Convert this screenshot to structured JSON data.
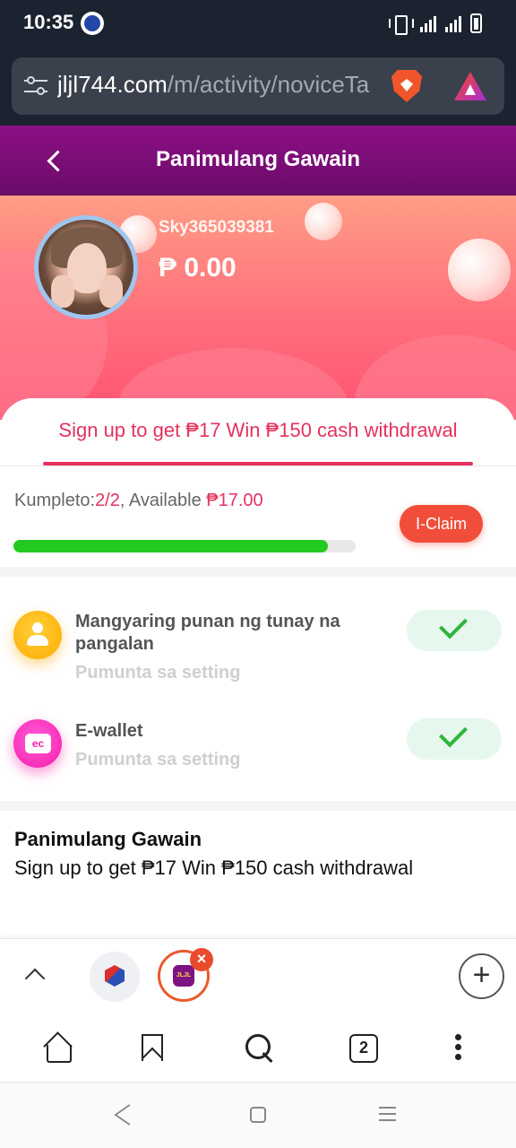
{
  "status_bar": {
    "time": "10:35"
  },
  "browser": {
    "url_host": "jljl744.com",
    "url_path": "/m/activity/noviceTa",
    "tabs_count": "2",
    "new_tab_symbol": "+",
    "tab_logo_text": "JLJL",
    "close_symbol": "×"
  },
  "header": {
    "title": "Panimulang Gawain"
  },
  "profile": {
    "username": "Sky365039381",
    "balance": "₱ 0.00"
  },
  "tab": {
    "label": "Sign up to get ₱17  Win ₱150 cash withdrawal"
  },
  "progress": {
    "label_prefix": "Kumpleto:",
    "completed": "2/2",
    "available_label": ", Available ",
    "available_amount": "₱17.00",
    "claim_label": "I-Claim",
    "fill_fraction": 0.92
  },
  "tasks": [
    {
      "icon": "user-icon",
      "title_line1": "Mangyaring punan ng tunay na",
      "title_line2": "pangalan",
      "subtitle": "Pumunta sa setting",
      "status": "completed"
    },
    {
      "icon": "ewallet-icon",
      "icon_text": "ec",
      "title_line1": "E-wallet",
      "subtitle": "Pumunta sa setting",
      "status": "completed"
    }
  ],
  "description": {
    "title": "Panimulang Gawain",
    "body": "Sign up to get ₱17 Win ₱150 cash withdrawal"
  },
  "colors": {
    "header_purple": "#8c0f86",
    "accent_red": "#e5315d",
    "claim_orange": "#f04e3a",
    "progress_green": "#22c91e"
  }
}
